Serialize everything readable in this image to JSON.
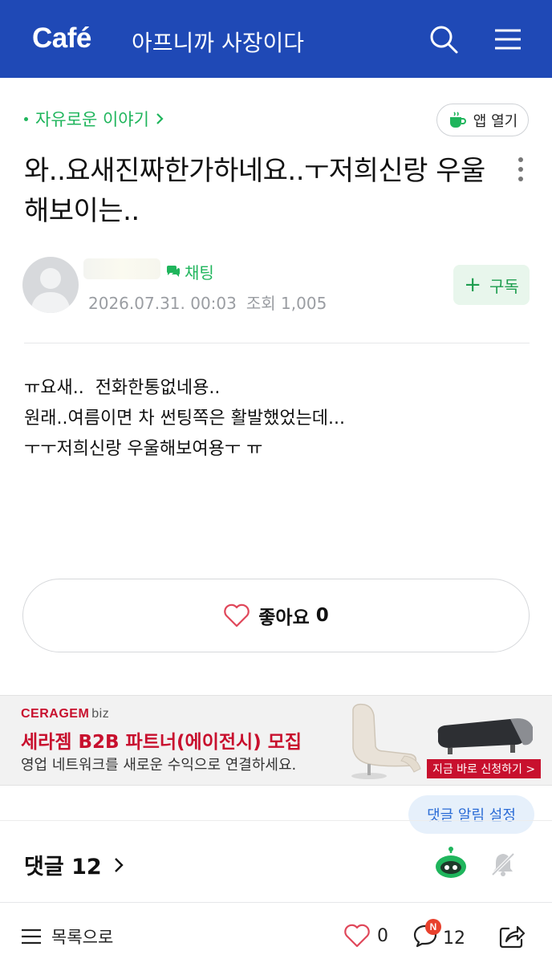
{
  "header": {
    "logo": "Café",
    "cafe_name": "아프니까 사장이다",
    "brand_color": "#1f49b6"
  },
  "post": {
    "board": "자유로운 이야기",
    "app_open_label": "앱 열기",
    "title": "와..요새진짜한가하네요..ㅜ저희신랑 우울해보이는..",
    "chat_label": "채팅",
    "date": "2026.07.31. 00:03",
    "views": "조회 1,005",
    "subscribe_label": "구독",
    "body_lines": [
      "ㅠ요새..  전화한통없네용..",
      "원래..여름이면 차 썬팅쪽은 활발했었는데...",
      "ㅜㅜ저희신랑 우울해보여용ㅜ ㅠ"
    ],
    "like_label": "좋아요",
    "like_count": "0"
  },
  "ad": {
    "brand": "CERAGEM",
    "brand_suffix": "biz",
    "headline": "세라젬 B2B 파트너(에이전시) 모집",
    "subtext": "영업 네트워크를 새로운 수익으로 연결하세요.",
    "cta": "지금 바로 신청하기 >"
  },
  "comments": {
    "label": "댓글 12",
    "notify_setting": "댓글 알림 설정"
  },
  "bottom_bar": {
    "list_label": "목록으로",
    "like_count": "0",
    "comment_count": "12",
    "comment_badge": "N"
  },
  "colors": {
    "green": "#1fb55c",
    "ad_red": "#c8102e"
  }
}
